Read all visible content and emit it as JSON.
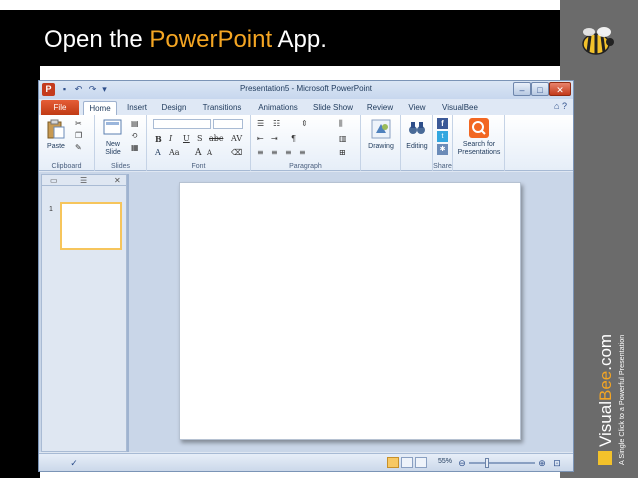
{
  "slide": {
    "title_prefix": "Open the ",
    "title_highlight": "PowerPoint",
    "title_suffix": " App."
  },
  "colors": {
    "highlight": "#f5a623",
    "band": "#000000",
    "side_panel": "#6b6b6b",
    "file_tab": "#c03a14"
  },
  "brand": {
    "name": "VisualBee.com",
    "tagline": "A Single Click to a Powerful Presentation"
  },
  "window": {
    "title": "Presentation5 - Microsoft PowerPoint",
    "app_icon_letter": "P"
  },
  "tabs": {
    "file": "File",
    "items": [
      "Home",
      "Insert",
      "Design",
      "Transitions",
      "Animations",
      "Slide Show",
      "Review",
      "View",
      "VisualBee"
    ],
    "active": "Home"
  },
  "ribbon": {
    "clipboard": {
      "paste": "Paste",
      "label": "Clipboard"
    },
    "slides": {
      "new_slide_line1": "New",
      "new_slide_line2": "Slide",
      "label": "Slides"
    },
    "font": {
      "label": "Font",
      "bold": "B",
      "italic": "I",
      "underline": "U",
      "strike": "S",
      "abc": "abc",
      "av": "AV",
      "grow": "A",
      "shrink": "A",
      "aa": "Aa"
    },
    "paragraph": {
      "label": "Paragraph"
    },
    "drawing": {
      "label": "Drawing"
    },
    "editing": {
      "label": "Editing"
    },
    "share": {
      "label": "Share"
    },
    "search": {
      "line1": "Search for",
      "line2": "Presentations"
    }
  },
  "thumbnails": {
    "items": [
      "1"
    ]
  },
  "status": {
    "zoom": "55%"
  }
}
